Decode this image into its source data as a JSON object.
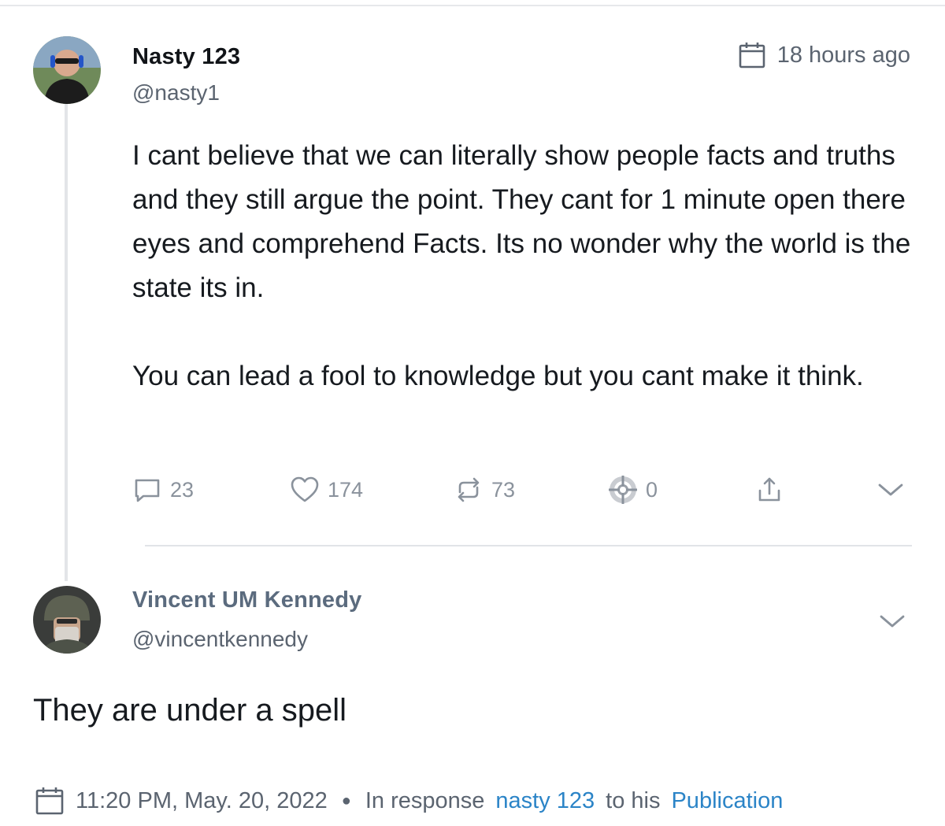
{
  "post": {
    "author_name": "Nasty 123",
    "author_handle": "@nasty1",
    "timestamp": "18 hours ago",
    "paragraph_1": "I cant believe that we can literally show people facts and truths and they still argue the point. They cant for 1 minute open there eyes and comprehend Facts. Its no wonder why the world is the state its in.",
    "paragraph_2": "You can lead a fool to knowledge but you cant make it think.",
    "actions": {
      "replies": "23",
      "likes": "174",
      "reposts": "73",
      "target": "0"
    }
  },
  "reply": {
    "author_name": "Vincent UM Kennedy",
    "author_handle": "@vincentkennedy",
    "text": "They are under a spell",
    "date": "11:20 PM, May. 20, 2022",
    "response_prefix": "In response",
    "response_user": "nasty 123",
    "response_middle": "to his",
    "response_target": "Publication"
  },
  "colors": {
    "accent": "#2b84c7",
    "muted": "#5b6470",
    "icon": "#8a929c"
  }
}
